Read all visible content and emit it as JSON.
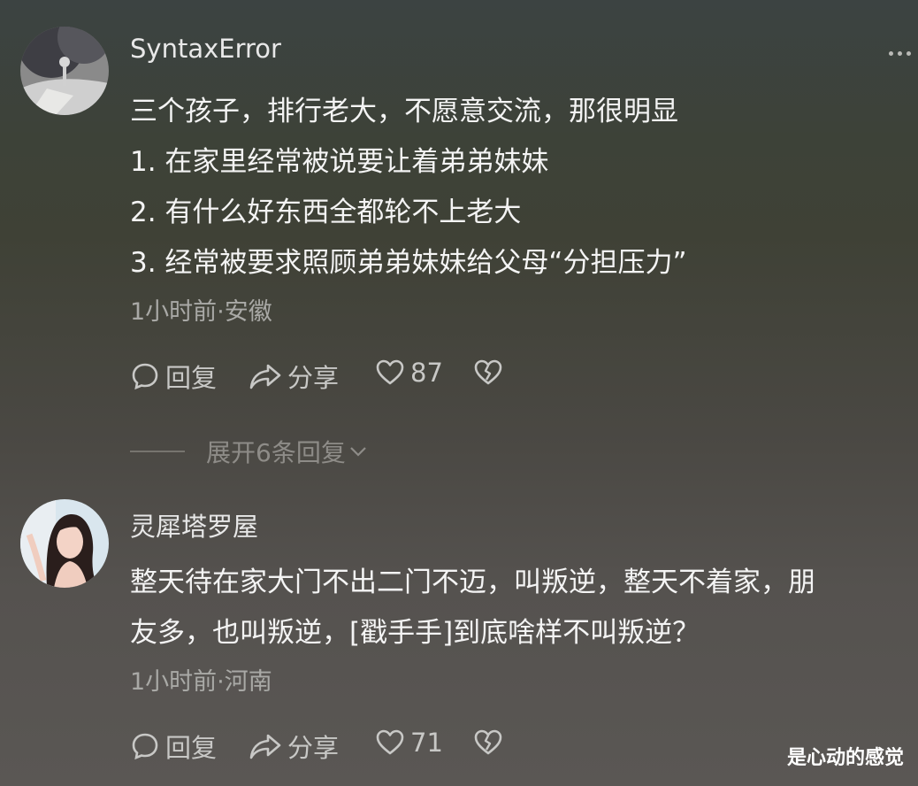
{
  "comments": [
    {
      "username": "SyntaxError",
      "lines": [
        "三个孩子，排行老大，不愿意交流，那很明显",
        "1. 在家里经常被说要让着弟弟妹妹",
        "2. 有什么好东西全都轮不上老大",
        "3. 经常被要求照顾弟弟妹妹给父母“分担压力”"
      ],
      "meta": "1小时前·安徽",
      "actions": {
        "reply": "回复",
        "share": "分享",
        "likes": "87"
      },
      "expand_replies": "展开6条回复"
    },
    {
      "username": "灵犀塔罗屋",
      "lines": [
        "整天待在家大门不出二门不迈，叫叛逆，整天不着家，朋",
        "友多，也叫叛逆，[戳手手]到底啥样不叫叛逆？"
      ],
      "meta": "1小时前·河南",
      "actions": {
        "reply": "回复",
        "share": "分享",
        "likes": "71"
      }
    }
  ],
  "watermark": "是心动的感觉",
  "colors": {
    "background": "#45463f",
    "text": "#f4f4f4",
    "meta": "#a9a9a6",
    "action": "#c8c8c6"
  },
  "icons": [
    "more-dots-icon",
    "comment-bubble-icon",
    "share-arrow-icon",
    "heart-icon",
    "broken-heart-icon",
    "chevron-down-icon"
  ]
}
